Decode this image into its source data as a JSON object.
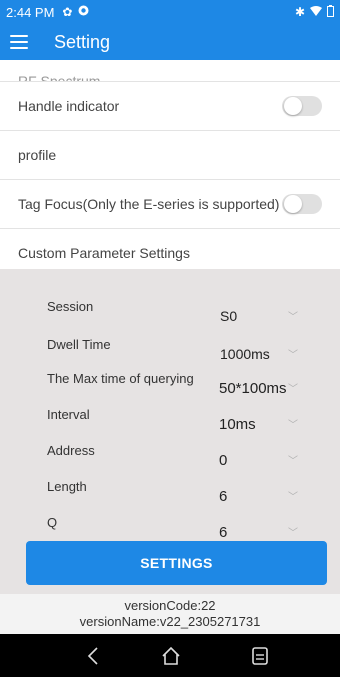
{
  "status_bar": {
    "time": "2:44 PM",
    "left_icons": [
      "settings-gear-icon",
      "notification-icon"
    ],
    "right_icons": [
      "bluetooth-icon",
      "wifi-icon",
      "battery-icon"
    ]
  },
  "app_bar": {
    "title": "Setting",
    "menu_icon": "menu-icon"
  },
  "settings_list": {
    "partial_item": "RF Spectrum",
    "items": [
      {
        "label": "Handle indicator",
        "toggle": false
      },
      {
        "label": "profile"
      },
      {
        "label": "Tag Focus(Only the E-series is supported)",
        "toggle": false
      },
      {
        "label": "Custom Parameter Settings"
      }
    ]
  },
  "params": [
    {
      "label": "Session",
      "value": "S0"
    },
    {
      "label": "Dwell Time",
      "value": "1000ms"
    },
    {
      "label": "The Max time of querying",
      "value": "50*100ms"
    },
    {
      "label": "Interval",
      "value": "10ms"
    },
    {
      "label": "Address",
      "value": "0"
    },
    {
      "label": "Length",
      "value": "6"
    },
    {
      "label": "Q",
      "value": "6"
    }
  ],
  "settings_button": "SETTINGS",
  "version": {
    "code": "versionCode:22",
    "name": "versionName:v22_2305271731"
  },
  "nav_bar": [
    "back-icon",
    "home-icon",
    "recents-icon"
  ],
  "colors": {
    "primary": "#1e88e5",
    "panel_bg": "#e6e3e3",
    "nav_bg": "#000000"
  }
}
